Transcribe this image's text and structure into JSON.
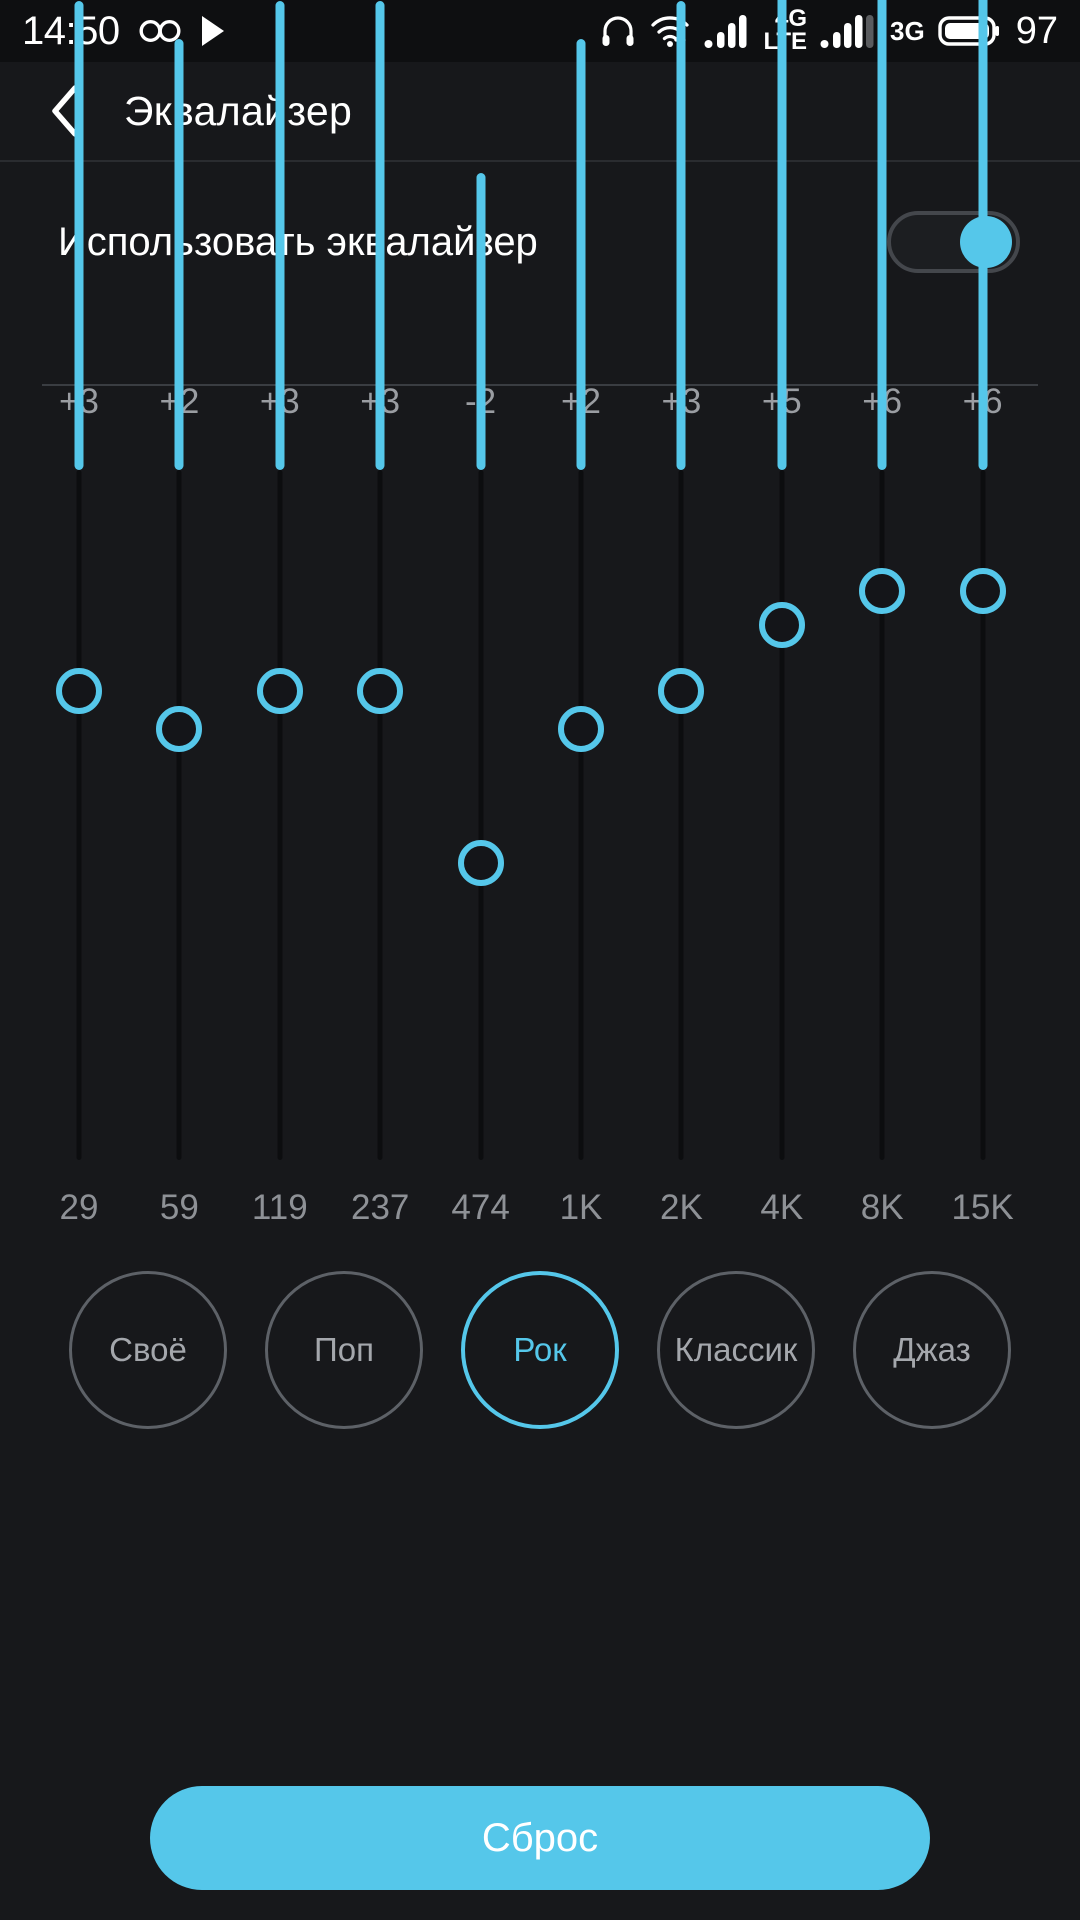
{
  "statusbar": {
    "time": "14:50",
    "icons_left": [
      "infinity-icon",
      "play-icon"
    ],
    "icons_right": [
      "headphones-icon",
      "wifi-upload-icon",
      "signal-bars-icon",
      "network-4g-lte-icon",
      "signal-bars-2-icon",
      "network-3g-icon",
      "battery-icon"
    ],
    "network_primary": "4G",
    "network_primary_sub": "LTE",
    "network_secondary": "3G",
    "battery_percent": "97"
  },
  "appbar": {
    "back_icon": "chevron-left-icon",
    "title": "Эквалайзер"
  },
  "enable_row": {
    "label": "Использовать эквалайзер",
    "toggle_state": "on"
  },
  "colors": {
    "accent": "#55c7ea",
    "background": "#17181b",
    "statusbar_bg": "#0e0f11",
    "track": "#0c0d0f",
    "muted_text": "#9a9da2"
  },
  "chart_data": {
    "type": "bar",
    "title": "",
    "xlabel": "",
    "ylabel": "",
    "ylim": [
      -15,
      15
    ],
    "categories": [
      "29",
      "59",
      "119",
      "237",
      "474",
      "1K",
      "2K",
      "4K",
      "8K",
      "15K"
    ],
    "values": [
      3,
      2,
      3,
      3,
      -2,
      2,
      3,
      5,
      6,
      6
    ],
    "gain_labels": [
      "+3",
      "+2",
      "+3",
      "+3",
      "-2",
      "+2",
      "+3",
      "+5",
      "+6",
      "+6"
    ],
    "thumb_positions_pct": [
      32,
      37.5,
      32,
      32,
      57,
      37.5,
      32,
      22.5,
      17.5,
      17.5
    ]
  },
  "presets": {
    "items": [
      {
        "label": "Своё",
        "selected": false
      },
      {
        "label": "Поп",
        "selected": false
      },
      {
        "label": "Рок",
        "selected": true
      },
      {
        "label": "Классик",
        "selected": false
      },
      {
        "label": "Джаз",
        "selected": false
      }
    ]
  },
  "reset": {
    "label": "Сброс"
  }
}
